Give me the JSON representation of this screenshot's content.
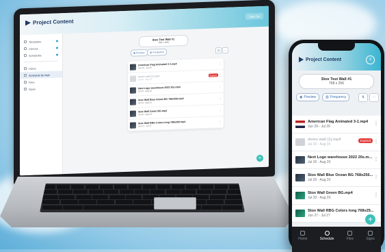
{
  "app": {
    "logo_text": "Project Content",
    "header_button": "Sign Out"
  },
  "laptop": {
    "sidebar": {
      "top_items": [
        {
          "label": "Templates"
        },
        {
          "label": "Canvas"
        },
        {
          "label": "Schedules"
        }
      ],
      "nav_items": [
        {
          "label": "Home"
        },
        {
          "label": "Schedule by tags"
        },
        {
          "label": "Files"
        },
        {
          "label": "Signs"
        }
      ]
    },
    "wall": {
      "name": "Stox Test Wall #1",
      "size": "768 x 256"
    },
    "preview_label": "Preview",
    "frequency_label": "Frequency",
    "expired_label": "Expired",
    "items": [
      {
        "name": "American Flag Animated 3-1.mp4",
        "dates": "Jun 29 - Jul 29"
      },
      {
        "name": "demo wall (1).mp4",
        "dates": "Jul 20 - Aug 20"
      },
      {
        "name": "Next Logo warehouse 2022 20s.mp4",
        "dates": "Jul 20 - Aug 20"
      },
      {
        "name": "Stox Wall Blue Ocean BG 768x256.mp4",
        "dates": "Jul 20 - Aug 20"
      },
      {
        "name": "Stox Wall Green BG.mp4",
        "dates": "Jul 20 - Aug 20"
      },
      {
        "name": "Stox Wall RBG Colors long 768x256.mp4",
        "dates": "Jun 27 - Jul 27"
      }
    ]
  },
  "phone": {
    "wall": {
      "name": "Stox Test Wall #1",
      "size": "768 x 256"
    },
    "preview_label": "Preview",
    "frequency_label": "Frequency",
    "expired_label": "Expired",
    "items": [
      {
        "name": "American Flag Animated 3-1.mp4",
        "dates": "Jun 29 - Jul 29"
      },
      {
        "name": "demo wall (1).mp4",
        "dates": "Jul 20 - Aug 20"
      },
      {
        "name": "Next Logo warehouse 2022 20s.m...",
        "dates": "Jul 20 - Aug 20"
      },
      {
        "name": "Stox Wall Blue Ocean BG 768x256...",
        "dates": "Jul 20 - Aug 20"
      },
      {
        "name": "Stox Wall Green BG.mp4",
        "dates": "Jul 20 - Aug 20"
      },
      {
        "name": "Stox Wall RBG Colors long 768x25...",
        "dates": "Jun 27 - Jul 27"
      }
    ],
    "nav": [
      {
        "label": "Home"
      },
      {
        "label": "Schedule"
      },
      {
        "label": "Files"
      },
      {
        "label": "Signs"
      }
    ]
  },
  "colors": {
    "brand": "#1f3a66",
    "accent": "#3bc1b9",
    "expired": "#e23b3b",
    "link": "#3a6fb0"
  }
}
